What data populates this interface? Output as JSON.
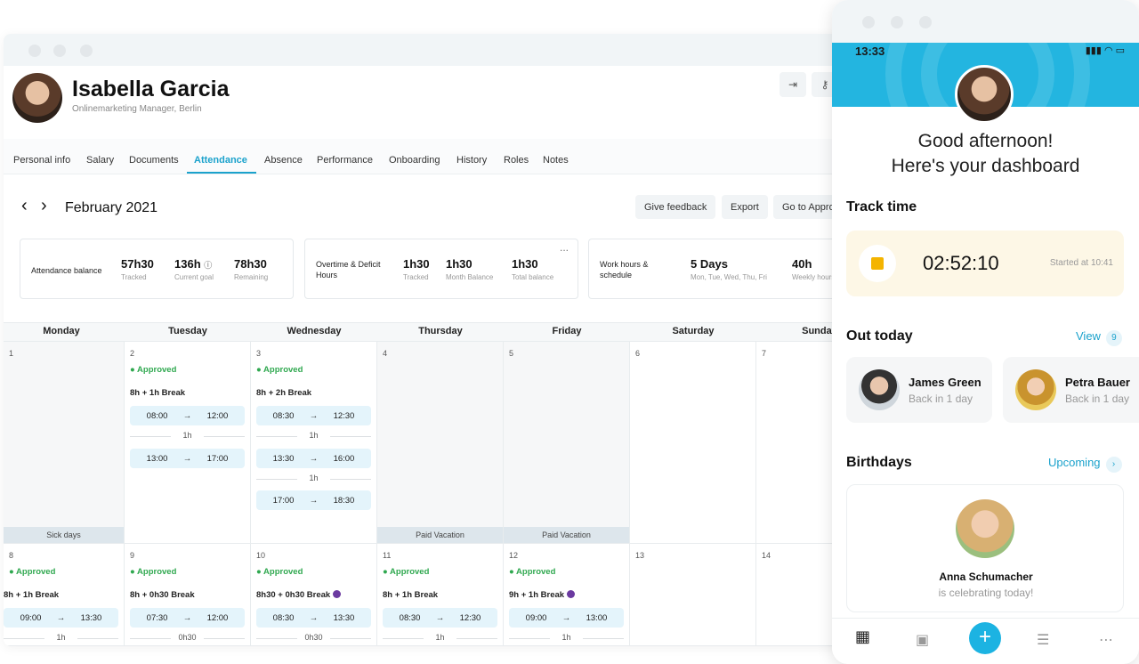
{
  "profile": {
    "name": "Isabella Garcia",
    "role": "Onlinemarketing Manager, Berlin"
  },
  "tabs": [
    "Personal info",
    "Salary",
    "Documents",
    "Attendance",
    "Absence",
    "Performance",
    "Onboarding",
    "History",
    "Roles",
    "Notes"
  ],
  "active_tab": "Attendance",
  "month_nav": {
    "prev": "‹",
    "next": "›",
    "label": "February 2021"
  },
  "actions": {
    "feedback": "Give feedback",
    "export": "Export",
    "approve": "Go to Approv"
  },
  "summary": {
    "attendance": {
      "label": "Attendance balance",
      "stats": [
        {
          "v": "57h30",
          "s": "Tracked"
        },
        {
          "v": "136h",
          "s": "Current goal"
        },
        {
          "v": "78h30",
          "s": "Remaining"
        }
      ]
    },
    "overtime": {
      "label": "Overtime & Deficit Hours",
      "menu": "...",
      "stats": [
        {
          "v": "1h30",
          "s": "Tracked"
        },
        {
          "v": "1h30",
          "s": "Month Balance"
        },
        {
          "v": "1h30",
          "s": "Total balance"
        }
      ]
    },
    "schedule": {
      "label": "Work hours & schedule",
      "stats": [
        {
          "v": "5 Days",
          "s": "Mon, Tue, Wed, Thu, Fri"
        },
        {
          "v": "40h",
          "s": "Weekly hours"
        }
      ]
    }
  },
  "days": [
    "Monday",
    "Tuesday",
    "Wednesday",
    "Thursday",
    "Friday",
    "Saturday",
    "Sunday"
  ],
  "week1": {
    "d1": {
      "num": "1",
      "foot": "Sick days"
    },
    "d2": {
      "num": "2",
      "status": "Approved",
      "break": "8h + 1h Break",
      "s1a": "08:00",
      "s1b": "12:00",
      "gap": "1h",
      "s2a": "13:00",
      "s2b": "17:00"
    },
    "d3": {
      "num": "3",
      "status": "Approved",
      "break": "8h + 2h Break",
      "s1a": "08:30",
      "s1b": "12:30",
      "gap1": "1h",
      "s2a": "13:30",
      "s2b": "16:00",
      "gap2": "1h",
      "s3a": "17:00",
      "s3b": "18:30"
    },
    "d4": {
      "num": "4",
      "foot": "Paid Vacation"
    },
    "d5": {
      "num": "5",
      "foot": "Paid Vacation"
    },
    "d6": {
      "num": "6"
    },
    "d7": {
      "num": "7"
    }
  },
  "week2": {
    "d8": {
      "num": "8",
      "status": "Approved",
      "break": "8h + 1h Break",
      "a": "09:00",
      "b": "13:30",
      "gap": "1h"
    },
    "d9": {
      "num": "9",
      "status": "Approved",
      "break": "8h + 0h30 Break",
      "a": "07:30",
      "b": "12:00",
      "gap": "0h30"
    },
    "d10": {
      "num": "10",
      "status": "Approved",
      "break": "8h30 + 0h30 Break",
      "a": "08:30",
      "b": "13:30",
      "gap": "0h30"
    },
    "d11": {
      "num": "11",
      "status": "Approved",
      "break": "8h + 1h Break",
      "a": "08:30",
      "b": "12:30",
      "gap": "1h"
    },
    "d12": {
      "num": "12",
      "status": "Approved",
      "break": "9h + 1h Break",
      "a": "09:00",
      "b": "13:00",
      "gap": "1h"
    },
    "d13": {
      "num": "13"
    },
    "d14": {
      "num": "14"
    }
  },
  "arrow": "→",
  "phone": {
    "time": "13:33",
    "status_icons": "▮▮▮ ◠ ▭",
    "greet1": "Good afternoon!",
    "greet2": "Here's your dashboard",
    "track_title": "Track time",
    "timer": "02:52:10",
    "started": "Started at 10:41",
    "out_title": "Out today",
    "out_link": "View",
    "out_count": "9",
    "people": [
      {
        "name": "James Green",
        "sub": "Back in 1 day"
      },
      {
        "name": "Petra Bauer",
        "sub": "Back in 1 day"
      }
    ],
    "bday_title": "Birthdays",
    "bday_link": "Upcoming",
    "bday_chevron": "›",
    "bday_name": "Anna Schumacher",
    "bday_sub": "is celebrating today!",
    "fab": "+"
  },
  "colors": {
    "accent": "#1ba2cc",
    "approved": "#2fa84f",
    "hero": "#23b5e0",
    "timer_bg": "#fdf7e6"
  }
}
